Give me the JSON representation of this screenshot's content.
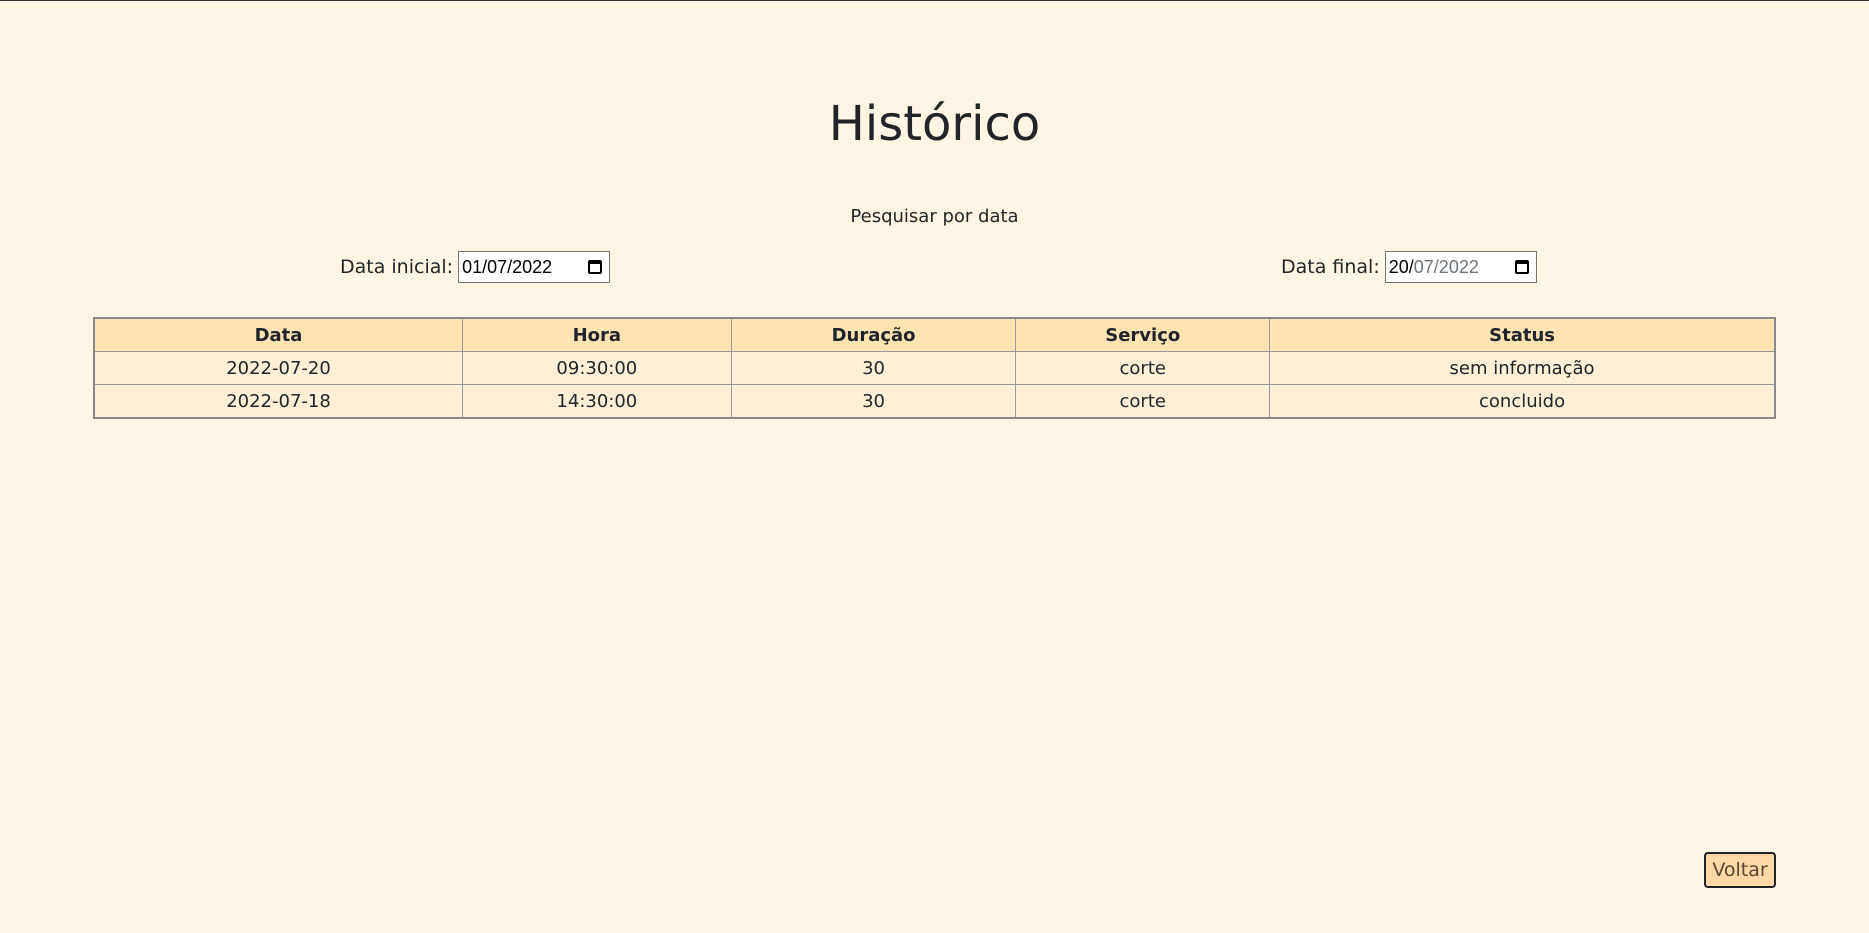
{
  "page": {
    "title": "Histórico",
    "search_label": "Pesquisar por data"
  },
  "filters": {
    "start_label": "Data inicial:",
    "start_value": "01/07/2022",
    "end_label": "Data final:",
    "end_value_day": "20/",
    "end_value_rest": "07/2022"
  },
  "table": {
    "headers": [
      "Data",
      "Hora",
      "Duração",
      "Serviço",
      "Status"
    ],
    "rows": [
      [
        "2022-07-20",
        "09:30:00",
        "30",
        "corte",
        "sem informação"
      ],
      [
        "2022-07-18",
        "14:30:00",
        "30",
        "corte",
        "concluido"
      ]
    ]
  },
  "actions": {
    "back_label": "Voltar"
  },
  "colors": {
    "background": "#fff5e4",
    "header_bg": "#ffe3b3",
    "cell_bg": "#ffefd5",
    "button_bg": "#ffd8a8"
  }
}
